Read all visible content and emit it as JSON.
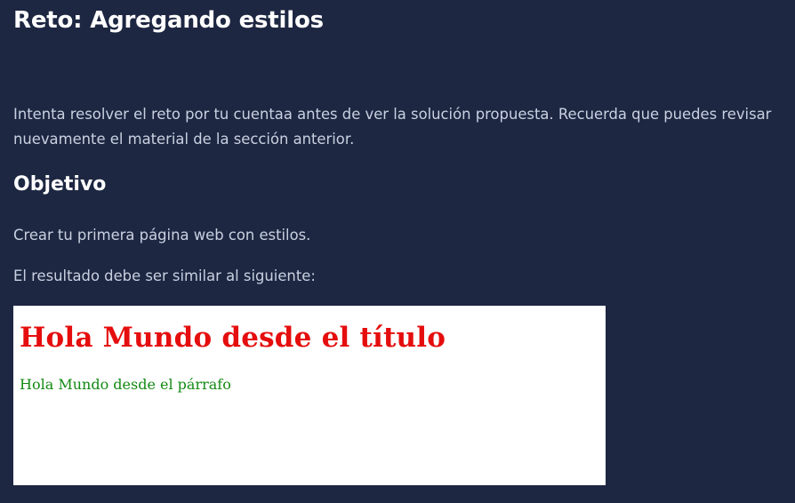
{
  "header": {
    "title": "Reto: Agregando estilos"
  },
  "intro": {
    "text": "Intenta resolver el reto por tu cuentaa antes de ver la solución propuesta. Recuerda que puedes revisar nuevamente el material de la sección anterior."
  },
  "objective": {
    "heading": "Objetivo",
    "description": "Crear tu primera página web con estilos.",
    "result_note": "El resultado debe ser similar al siguiente:"
  },
  "preview": {
    "title": "Hola Mundo desde el título",
    "paragraph": "Hola Mundo desde el párrafo",
    "title_color": "#e50d0d",
    "paragraph_color": "#138a13",
    "background": "#ffffff"
  },
  "theme": {
    "page_background": "#1d2742",
    "heading_color": "#ffffff",
    "text_color": "#c9d0e0"
  }
}
